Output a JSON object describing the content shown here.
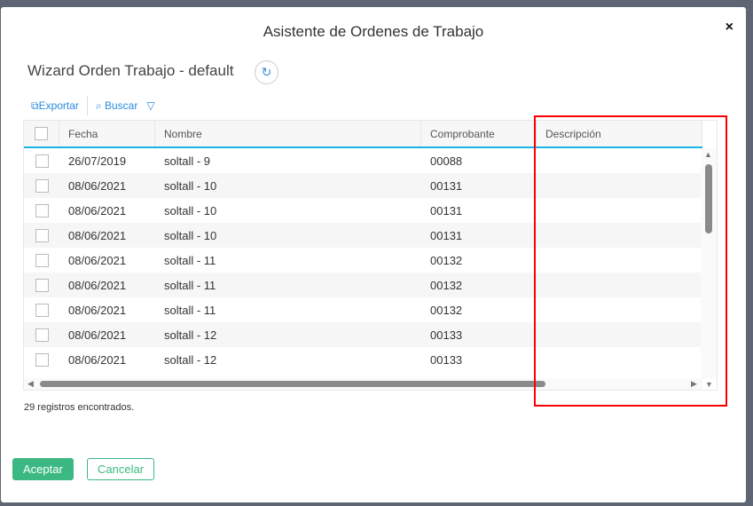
{
  "dialog": {
    "title": "Asistente de Ordenes de Trabajo",
    "close": "×"
  },
  "subtitle": "Wizard Orden Trabajo - default",
  "toolbar": {
    "export": "Exportar",
    "search": "Buscar",
    "refresh_icon": "↻",
    "filter_icon": "▽"
  },
  "columns": [
    "Fecha",
    "Nombre",
    "Comprobante",
    "Descripción"
  ],
  "rows": [
    [
      "26/07/2019",
      "soltall - 9",
      "00088",
      ""
    ],
    [
      "08/06/2021",
      "soltall - 10",
      "00131",
      ""
    ],
    [
      "08/06/2021",
      "soltall - 10",
      "00131",
      ""
    ],
    [
      "08/06/2021",
      "soltall - 10",
      "00131",
      ""
    ],
    [
      "08/06/2021",
      "soltall - 11",
      "00132",
      ""
    ],
    [
      "08/06/2021",
      "soltall - 11",
      "00132",
      ""
    ],
    [
      "08/06/2021",
      "soltall - 11",
      "00132",
      ""
    ],
    [
      "08/06/2021",
      "soltall - 12",
      "00133",
      ""
    ],
    [
      "08/06/2021",
      "soltall - 12",
      "00133",
      ""
    ]
  ],
  "footer": {
    "count": "29 registros encontrados.",
    "accept": "Aceptar",
    "cancel": "Cancelar"
  }
}
